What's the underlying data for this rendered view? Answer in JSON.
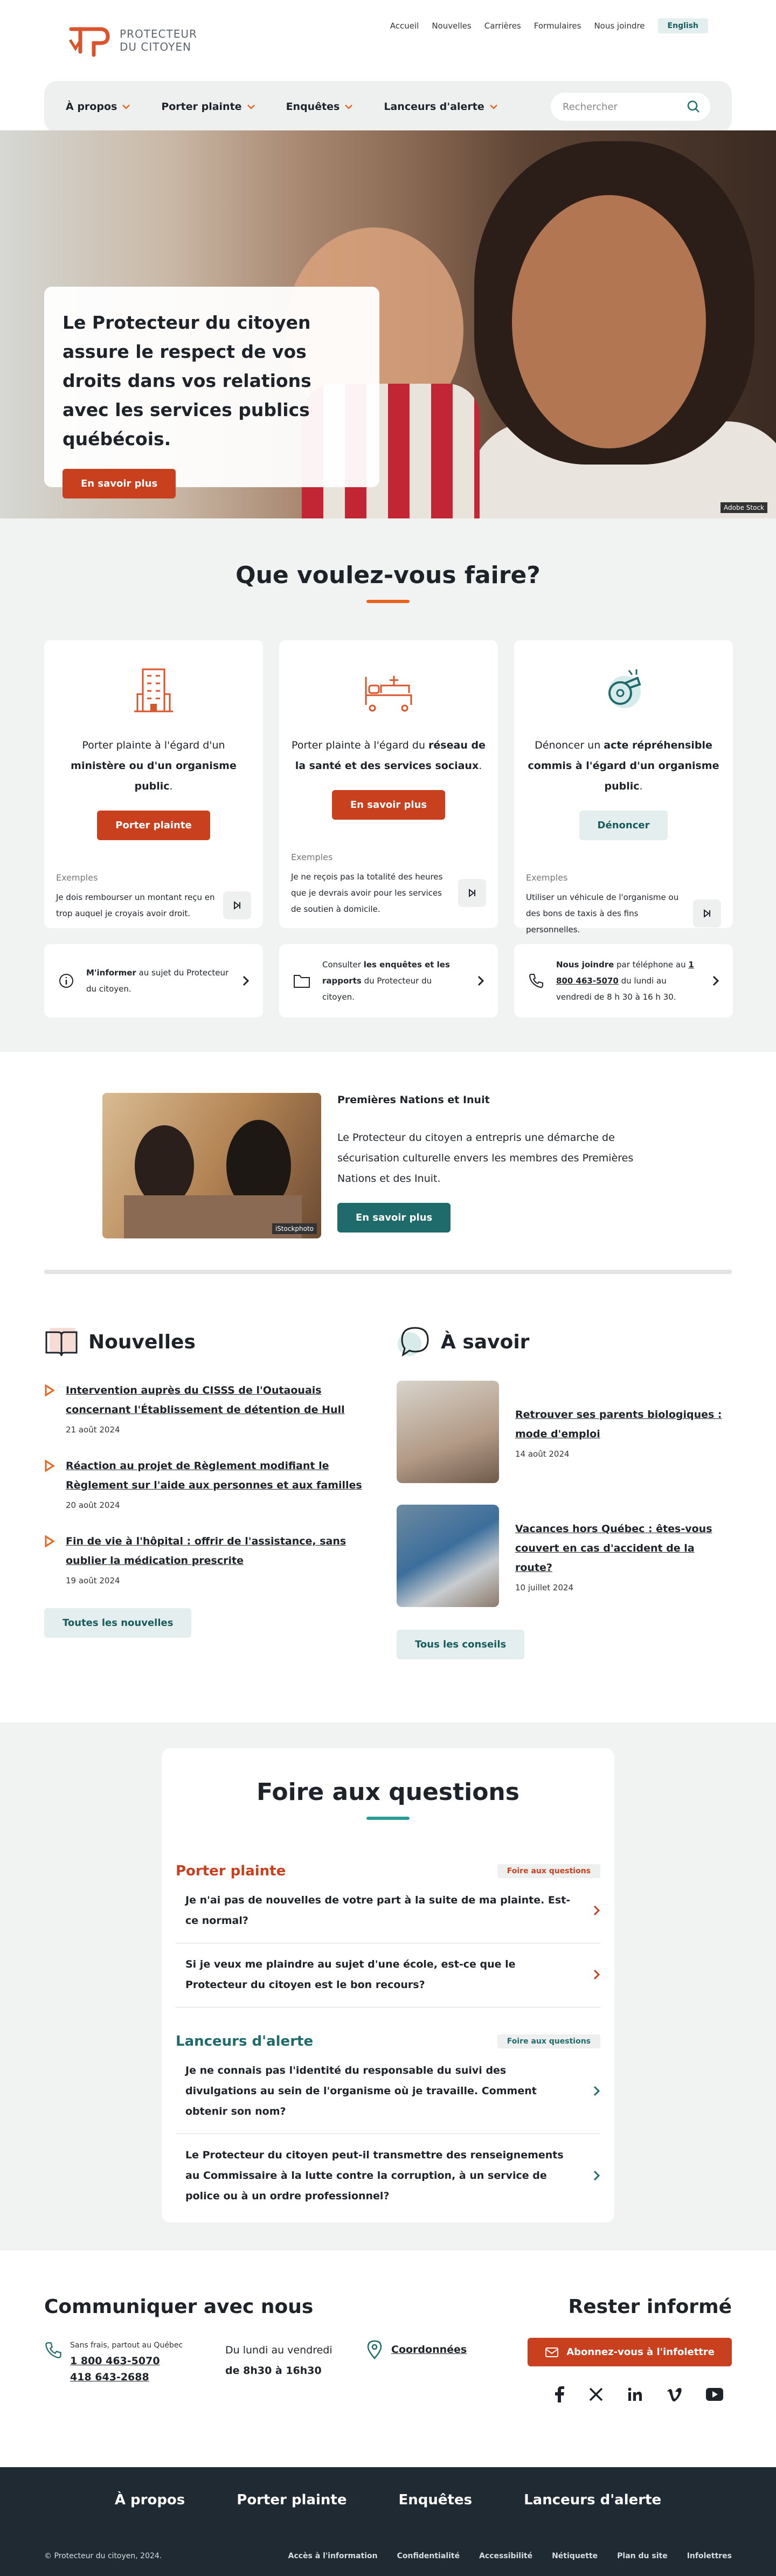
{
  "header": {
    "logo_line1": "PROTECTEUR",
    "logo_line2": "DU CITOYEN",
    "utility": [
      "Accueil",
      "Nouvelles",
      "Carrières",
      "Formulaires",
      "Nous joindre"
    ],
    "language": "English"
  },
  "nav": {
    "items": [
      "À propos",
      "Porter plainte",
      "Enquêtes",
      "Lanceurs d'alerte"
    ],
    "search_placeholder": "Rechercher"
  },
  "hero": {
    "title": "Le Protecteur du citoyen assure le respect de vos droits dans vos relations avec les services publics québécois.",
    "button": "En savoir plus",
    "credit": "Adobe Stock"
  },
  "actions": {
    "title": "Que voulez-vous faire?",
    "cards": [
      {
        "pre": "Porter plainte à l'égard d'un ",
        "strong": "ministère ou d'un organisme public",
        "post": ".",
        "button": "Porter plainte",
        "examples_label": "Exemples",
        "example": "Je dois rembourser un montant reçu en trop auquel je croyais avoir droit."
      },
      {
        "pre": "Porter plainte à l'égard du ",
        "strong": "réseau de la santé et des services sociaux",
        "post": ".",
        "button": "En savoir plus",
        "examples_label": "Exemples",
        "example": "Je ne reçois pas la totalité des heures que je devrais avoir pour les services de soutien à domicile."
      },
      {
        "pre": "Dénoncer un ",
        "strong": "acte répréhensible commis à l'égard d'un organisme public",
        "post": ".",
        "button": "Dénoncer",
        "examples_label": "Exemples",
        "example": "Utiliser un véhicule de l'organisme ou des bons de taxis à des fins personnelles."
      }
    ],
    "links": [
      {
        "strong": "M'informer",
        "rest": " au sujet du Protecteur du citoyen."
      },
      {
        "pre": "Consulter ",
        "strong": "les enquêtes et les rapports",
        "rest": " du Protecteur du citoyen."
      },
      {
        "strong": "Nous joindre",
        "rest": " par téléphone au ",
        "phone": "1 800 463-5070",
        "rest2": " du lundi au vendredi de 8 h 30 à 16 h 30."
      }
    ]
  },
  "premieres_nations": {
    "title": "Premières Nations et Inuit",
    "text": "Le Protecteur du citoyen a entrepris une démarche de sécurisation culturelle envers les membres des Premières Nations et des Inuit.",
    "button": "En savoir plus",
    "credit": "iStockphoto"
  },
  "nouvelles": {
    "title": "Nouvelles",
    "items": [
      {
        "title": "Intervention auprès du CISSS de l'Outaouais concernant l'Établissement de détention de Hull",
        "date": "21 août 2024"
      },
      {
        "title": "Réaction au projet de Règlement modifiant le Règlement sur l'aide aux personnes et aux familles",
        "date": "20 août 2024"
      },
      {
        "title": "Fin de vie à l'hôpital : offrir de l'assistance, sans oublier la médication prescrite",
        "date": "19 août 2024"
      }
    ],
    "button": "Toutes les nouvelles"
  },
  "a_savoir": {
    "title": "À savoir",
    "items": [
      {
        "title": "Retrouver ses parents biologiques : mode d'emploi",
        "date": "14 août 2024"
      },
      {
        "title": "Vacances hors Québec : êtes-vous couvert en cas d'accident de la route?",
        "date": "10 juillet 2024"
      }
    ],
    "button": "Tous les conseils"
  },
  "faq": {
    "title": "Foire aux questions",
    "categories": [
      {
        "name": "Porter plainte",
        "tag": "Foire aux questions",
        "questions": [
          "Je n'ai pas de nouvelles de votre part à la suite de ma plainte. Est-ce normal?",
          "Si je veux me plaindre au sujet d'une école, est-ce que le Protecteur du citoyen est le bon recours?"
        ]
      },
      {
        "name": "Lanceurs d'alerte",
        "tag": "Foire aux questions",
        "questions": [
          "Je ne connais pas l'identité du responsable du suivi des divulgations au sein de l'organisme où je travaille. Comment obtenir son nom?",
          "Le Protecteur du citoyen peut-il transmettre des renseignements au Commissaire à la lutte contre la corruption, à un service de police ou à un ordre professionnel?"
        ]
      }
    ]
  },
  "contact": {
    "title": "Communiquer avec nous",
    "toll_free_label": "Sans frais, partout au Québec",
    "phone1": "1 800 463-5070",
    "phone2": "418 643-2688",
    "hours_line1": "Du lundi au vendredi",
    "hours_line2": "de 8h30 à 16h30",
    "coords": "Coordonnées",
    "newsletter_title": "Rester informé",
    "newsletter_button": "Abonnez-vous à l'infolettre",
    "social": [
      "facebook-icon",
      "x-icon",
      "linkedin-icon",
      "vimeo-icon",
      "youtube-icon"
    ]
  },
  "footer": {
    "nav": [
      "À propos",
      "Porter plainte",
      "Enquêtes",
      "Lanceurs d'alerte"
    ],
    "copyright": "© Protecteur du citoyen, 2024.",
    "legal": [
      "Accès à l'information",
      "Confidentialité",
      "Accessibilité",
      "Nétiquette",
      "Plan du site",
      "Infolettres"
    ]
  },
  "colors": {
    "accent_orange": "#c8401e",
    "teal": "#1f6b6b",
    "dark_footer": "#1f2a33",
    "light_gray_bg": "#f1f2f2"
  }
}
